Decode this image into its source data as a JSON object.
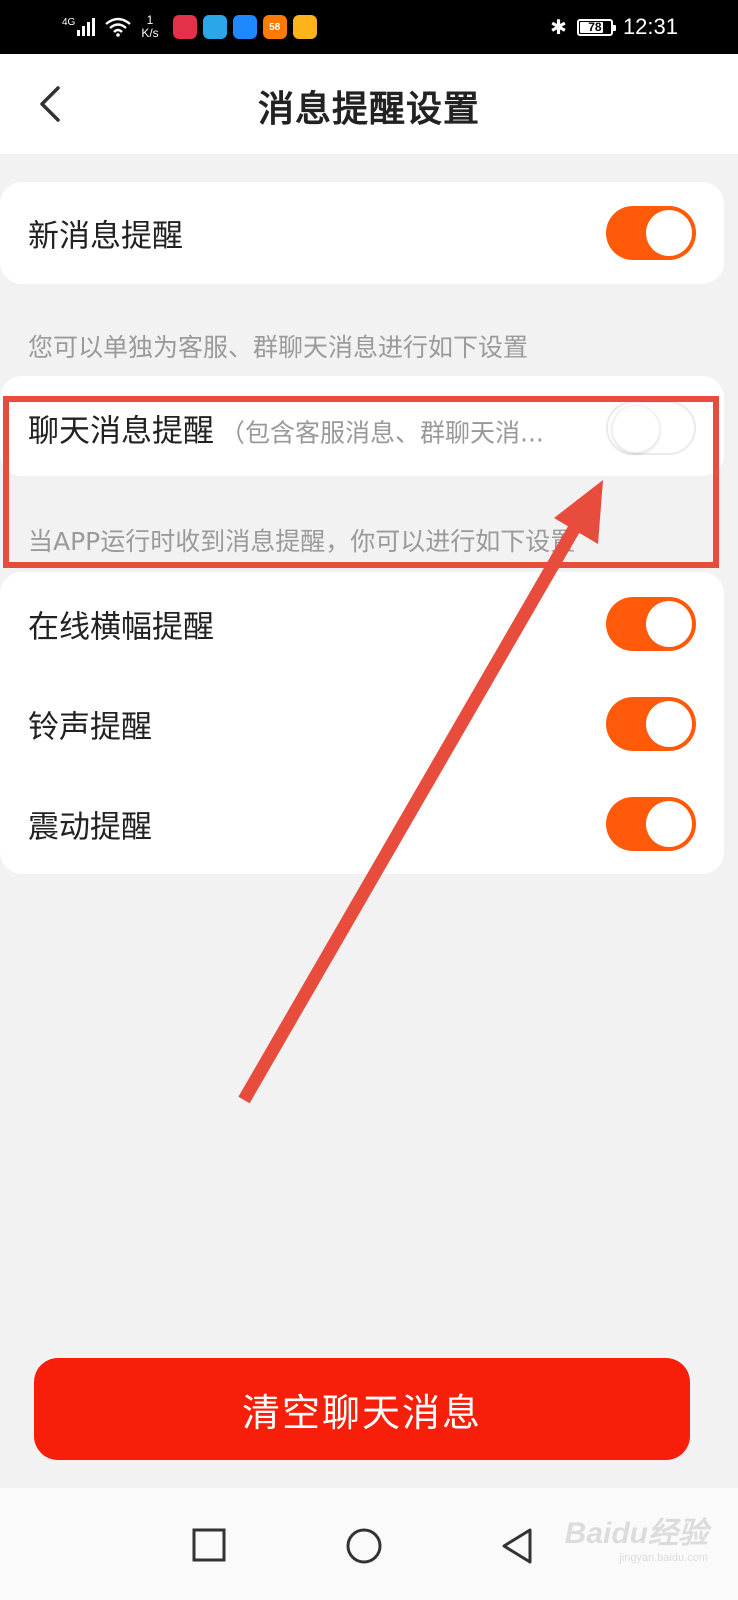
{
  "status_bar": {
    "network": "4G",
    "speed_value": "1",
    "speed_unit": "K/s",
    "apps": [
      {
        "icon": "calendar-app-icon",
        "label": "",
        "color": "#e3314a"
      },
      {
        "icon": "browser-app-icon",
        "label": "",
        "color": "#2aa7e8"
      },
      {
        "icon": "youku-app-icon",
        "label": "",
        "color": "#1e88ff"
      },
      {
        "icon": "58-app-icon",
        "label": "58",
        "color": "#ff7a00"
      },
      {
        "icon": "cup-app-icon",
        "label": "",
        "color": "#ffb31a"
      }
    ],
    "battery": "78",
    "battery_level": 0.78,
    "time": "12:31"
  },
  "header": {
    "title": "消息提醒设置"
  },
  "settings": {
    "new_message": {
      "label": "新消息提醒",
      "on": true
    },
    "hint_individual": "您可以单独为客服、群聊天消息进行如下设置",
    "chat_message": {
      "label": "聊天消息提醒",
      "sublabel": "（包含客服消息、群聊天消...",
      "on": false
    },
    "hint_app_running": "当APP运行时收到消息提醒，你可以进行如下设置",
    "banner": {
      "label": "在线横幅提醒",
      "on": true
    },
    "ringtone": {
      "label": "铃声提醒",
      "on": true
    },
    "vibration": {
      "label": "震动提醒",
      "on": true
    }
  },
  "clear_button": "清空聊天消息",
  "colors": {
    "accent": "#ff5a0a",
    "danger": "#f81f0a",
    "annotation": "#e84c3d"
  },
  "watermark": {
    "brand": "Baidu经验",
    "url": "jingyan.baidu.com"
  }
}
